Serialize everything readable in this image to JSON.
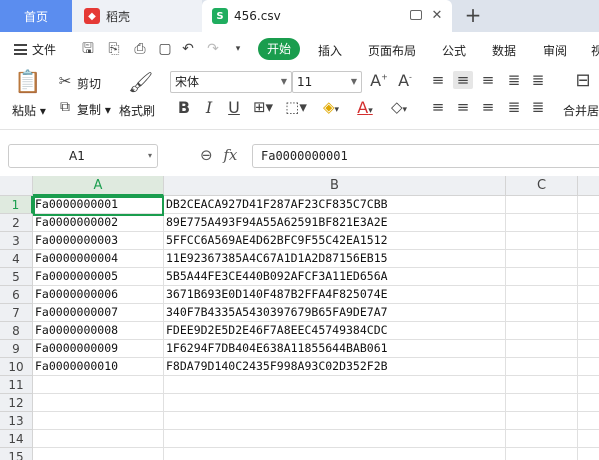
{
  "tabs": {
    "home": "首页",
    "shell": "稻壳",
    "file": "456.csv"
  },
  "menu": {
    "file": "文件",
    "start": "开始",
    "items": [
      "插入",
      "页面布局",
      "公式",
      "数据",
      "审阅",
      "视"
    ]
  },
  "ribbon": {
    "paste": "粘贴",
    "cut": "剪切",
    "copy": "复制",
    "format_painter": "格式刷",
    "font_name": "宋体",
    "font_size": "11",
    "merge": "合并居"
  },
  "formula_bar": {
    "cell_ref": "A1",
    "fx": "fx",
    "content": "Fa0000000001"
  },
  "sheet": {
    "columns": [
      "A",
      "B",
      "C"
    ],
    "row_numbers": [
      "1",
      "2",
      "3",
      "4",
      "5",
      "6",
      "7",
      "8",
      "9",
      "10",
      "11",
      "12",
      "13",
      "14",
      "15"
    ],
    "rows": [
      [
        "Fa0000000001",
        "DB2CEACA927D41F287AF23CF835C7CBB"
      ],
      [
        "Fa0000000002",
        "89E775A493F94A55A62591BF821E3A2E"
      ],
      [
        "Fa0000000003",
        "5FFCC6A569AE4D62BFC9F55C42EA1512"
      ],
      [
        "Fa0000000004",
        "11E92367385A4C67A1D1A2D87156EB15"
      ],
      [
        "Fa0000000005",
        "5B5A44FE3CE440B092AFCF3A11ED656A"
      ],
      [
        "Fa0000000006",
        "3671B693E0D140F487B2FFA4F825074E"
      ],
      [
        "Fa0000000007",
        "340F7B4335A5430397679B65FA9DE7A7"
      ],
      [
        "Fa0000000008",
        "FDEE9D2E5D2E46F7A8EEC45749384CDC"
      ],
      [
        "Fa0000000009",
        "1F6294F7DB404E638A11855644BAB061"
      ],
      [
        "Fa0000000010",
        "F8DA79D140C2435F998A93C02D352F2B"
      ]
    ]
  },
  "colors": {
    "accent_green": "#1a9d4e",
    "home_tab_blue": "#5b8def"
  }
}
